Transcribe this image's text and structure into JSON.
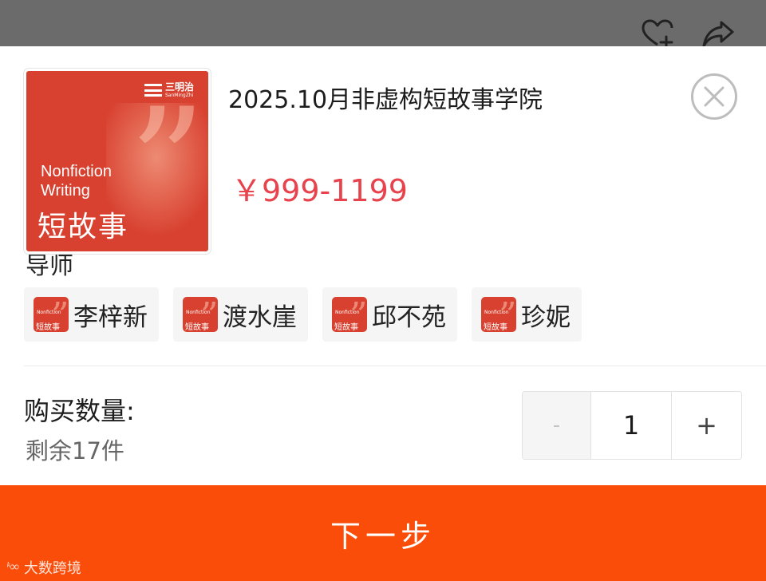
{
  "icons": {
    "favorite": "heart-plus-icon",
    "share": "share-arrow-icon",
    "close": "close-circle-icon"
  },
  "cover": {
    "logo_cn": "三明治",
    "logo_en": "SanMingZhi",
    "title_en_line1": "Nonfiction",
    "title_en_line2": "Writing",
    "title_cn": "短故事"
  },
  "product": {
    "title": "2025.10月非虚构短故事学院",
    "price": "￥999-1199"
  },
  "mentors": {
    "label": "导师",
    "items": [
      {
        "name": "李梓新"
      },
      {
        "name": "渡水崖"
      },
      {
        "name": "邱不苑"
      },
      {
        "name": "珍妮"
      }
    ]
  },
  "quantity": {
    "label": "购买数量:",
    "stock": "剩余17件",
    "minus": "-",
    "value": "1",
    "plus": "+"
  },
  "next_button": {
    "label": "下一步"
  },
  "watermark": {
    "mark": "ᵏ∞",
    "text": "大数跨境"
  },
  "colors": {
    "accent": "#fa4d0a",
    "price": "#e8424d",
    "cover": "#d8402f"
  }
}
